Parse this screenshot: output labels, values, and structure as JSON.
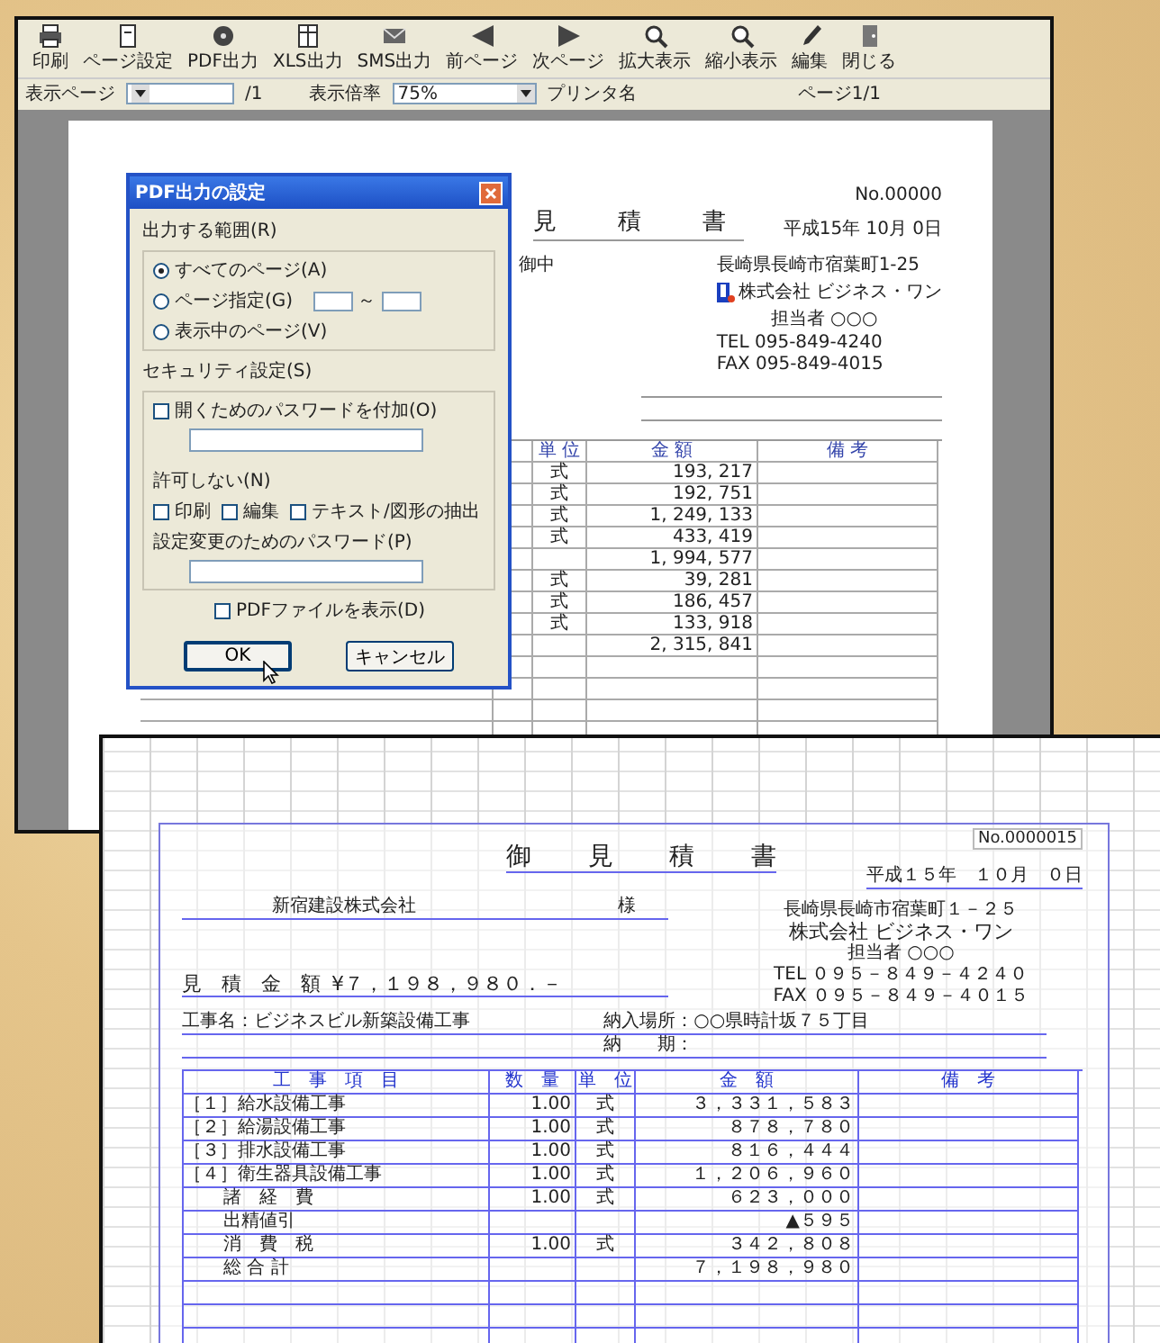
{
  "back_window": {
    "toolbar": [
      "印刷",
      "ページ設定",
      "PDF出力",
      "XLS出力",
      "SMS出力",
      "前ページ",
      "次ページ",
      "拡大表示",
      "縮小表示",
      "編集",
      "閉じる"
    ],
    "page_label": "表示ページ",
    "page_count": "/1",
    "zoom_label": "表示倍率",
    "zoom_value": "75%",
    "printer_label": "プリンタ名",
    "status": "ページ1/1",
    "document": {
      "number": "No.00000",
      "title_chars": [
        "見",
        "積",
        "書"
      ],
      "date": "平成15年 10月 0日",
      "addressee": "御中",
      "address": "長崎県長崎市宿葉町1-25",
      "company": "株式会社 ビジネス・ワン",
      "person": "担当者 ○○○",
      "tel": "TEL 095-849-4240",
      "fax": "FAX 095-849-4015",
      "columns": [
        "単 位",
        "金 額",
        "備 考"
      ],
      "rows": [
        {
          "unit": "式",
          "amount": "193, 217"
        },
        {
          "unit": "式",
          "amount": "192, 751"
        },
        {
          "unit": "式",
          "amount": "1, 249, 133"
        },
        {
          "unit": "式",
          "amount": "433, 419"
        },
        {
          "unit": "",
          "amount": "1, 994, 577"
        },
        {
          "unit": "式",
          "amount": "39, 281"
        },
        {
          "unit": "式",
          "amount": "186, 457"
        },
        {
          "unit": "式",
          "amount": "133, 918"
        },
        {
          "unit": "",
          "amount": "2, 315, 841"
        }
      ]
    },
    "dialog": {
      "title": "PDF出力の設定",
      "range_label": "出力する範囲(R)",
      "range_options": [
        {
          "label": "すべてのページ(A)",
          "selected": true
        },
        {
          "label": "ページ指定(G)",
          "selected": false
        },
        {
          "label": "表示中のページ(V)",
          "selected": false
        }
      ],
      "range_separator": "～",
      "security_label": "セキュリティ設定(S)",
      "open_password": {
        "label": "開くためのパスワードを付加(O)",
        "checked": false
      },
      "deny_label": "許可しない(N)",
      "deny_options": [
        {
          "label": "印刷",
          "checked": false
        },
        {
          "label": "編集",
          "checked": false
        },
        {
          "label": "テキスト/図形の抽出",
          "checked": false
        }
      ],
      "change_password_label": "設定変更のためのパスワード(P)",
      "show_pdf": {
        "label": "PDFファイルを表示(D)",
        "checked": false
      },
      "buttons": [
        "OK",
        "キャンセル"
      ]
    }
  },
  "front_window": {
    "number": "No.0000015",
    "title_chars": [
      "御",
      "見",
      "積",
      "書"
    ],
    "date": "平成１５年　１０月　０日",
    "client": "新宿建設株式会社",
    "honorific": "様",
    "address": "長崎県長崎市宿葉町１－２５",
    "company": "株式会社 ビジネス・ワン",
    "person": "担当者 ○○○",
    "tel": "TEL ０９５－８４９－４２４０",
    "fax": "FAX ０９５－８４９－４０１５",
    "total_label": "見　積　金　額",
    "total": "¥７，１９８，９８０．－",
    "project": "工事名：ビジネスビル新築設備工事",
    "place": "納入場所：○○県時計坂７５丁目",
    "deadline": "納　　期：",
    "columns": [
      "工　事　項　目",
      "数　量",
      "単　位",
      "金　額",
      "備　考"
    ],
    "rows": [
      {
        "kind": "item",
        "name": "［１］給水設備工事",
        "qty": "1.00",
        "unit": "式",
        "amount": "３，３３１，５８３"
      },
      {
        "kind": "item",
        "name": "［２］給湯設備工事",
        "qty": "1.00",
        "unit": "式",
        "amount": "８７８，７８０"
      },
      {
        "kind": "item",
        "name": "［３］排水設備工事",
        "qty": "1.00",
        "unit": "式",
        "amount": "８１６，４４４"
      },
      {
        "kind": "item",
        "name": "［４］衛生器具設備工事",
        "qty": "1.00",
        "unit": "式",
        "amount": "１，２０６，９６０"
      },
      {
        "kind": "sub",
        "name": "諸　経　費",
        "qty": "1.00",
        "unit": "式",
        "amount": "６２３，０００"
      },
      {
        "kind": "sub",
        "name": "出精値引",
        "qty": "",
        "unit": "",
        "amount": "▲５９５"
      },
      {
        "kind": "sub",
        "name": "消　費　税",
        "qty": "1.00",
        "unit": "式",
        "amount": "３４２，８０８"
      },
      {
        "kind": "sub",
        "name": "総 合 計",
        "qty": "",
        "unit": "",
        "amount": "７，１９８，９８０"
      }
    ]
  }
}
